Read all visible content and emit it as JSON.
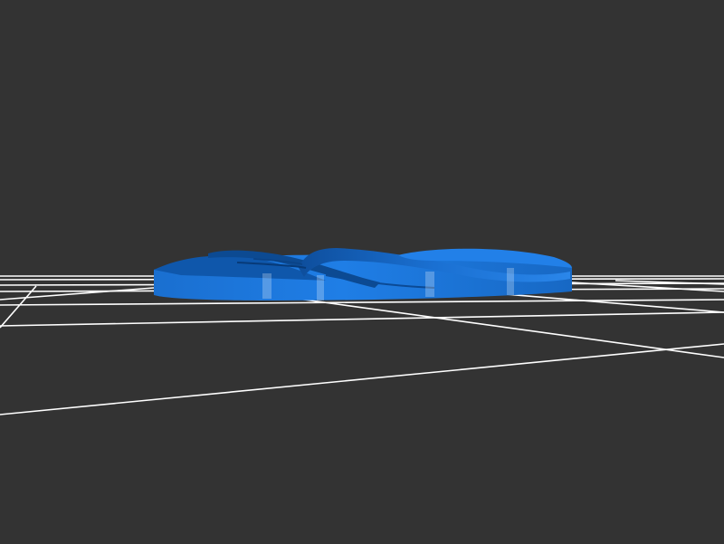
{
  "scene": {
    "background_color": "#333333",
    "grid_color": "#ffffff",
    "model_color": "#1a75d9",
    "model_shade_color": "#0d4f9e",
    "model_highlight_color": "#3d93f0",
    "model_icon": "blue-twisted-ribbon-model"
  }
}
